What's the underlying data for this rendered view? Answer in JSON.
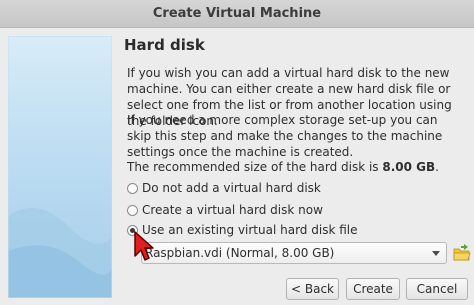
{
  "window": {
    "title": "Create Virtual Machine"
  },
  "page": {
    "heading": "Hard disk",
    "paragraph1": "If you wish you can add a virtual hard disk to the new machine. You can either create a new hard disk file or select one from the list or from another location using the folder icon.",
    "paragraph2": "If you need a more complex storage set-up you can skip this step and make the changes to the machine settings once the machine is created.",
    "recommended_prefix": "The recommended size of the hard disk is ",
    "recommended_size": "8.00 GB",
    "recommended_suffix": "."
  },
  "options": [
    {
      "label": "Do not add a virtual hard disk",
      "checked": false
    },
    {
      "label": "Create a virtual hard disk now",
      "checked": false
    },
    {
      "label": "Use an existing virtual hard disk file",
      "checked": true
    }
  ],
  "disk_select": {
    "value": "Raspbian.vdi (Normal, 8.00 GB)"
  },
  "icons": {
    "folder": "folder-open-icon",
    "cursor": "mouse-pointer-icon"
  },
  "buttons": {
    "back": "< Back",
    "create": "Create",
    "cancel": "Cancel"
  },
  "colors": {
    "cursor_fill": "#e02020",
    "folder_green": "#5aa532",
    "folder_yellow": "#f2c43a"
  }
}
